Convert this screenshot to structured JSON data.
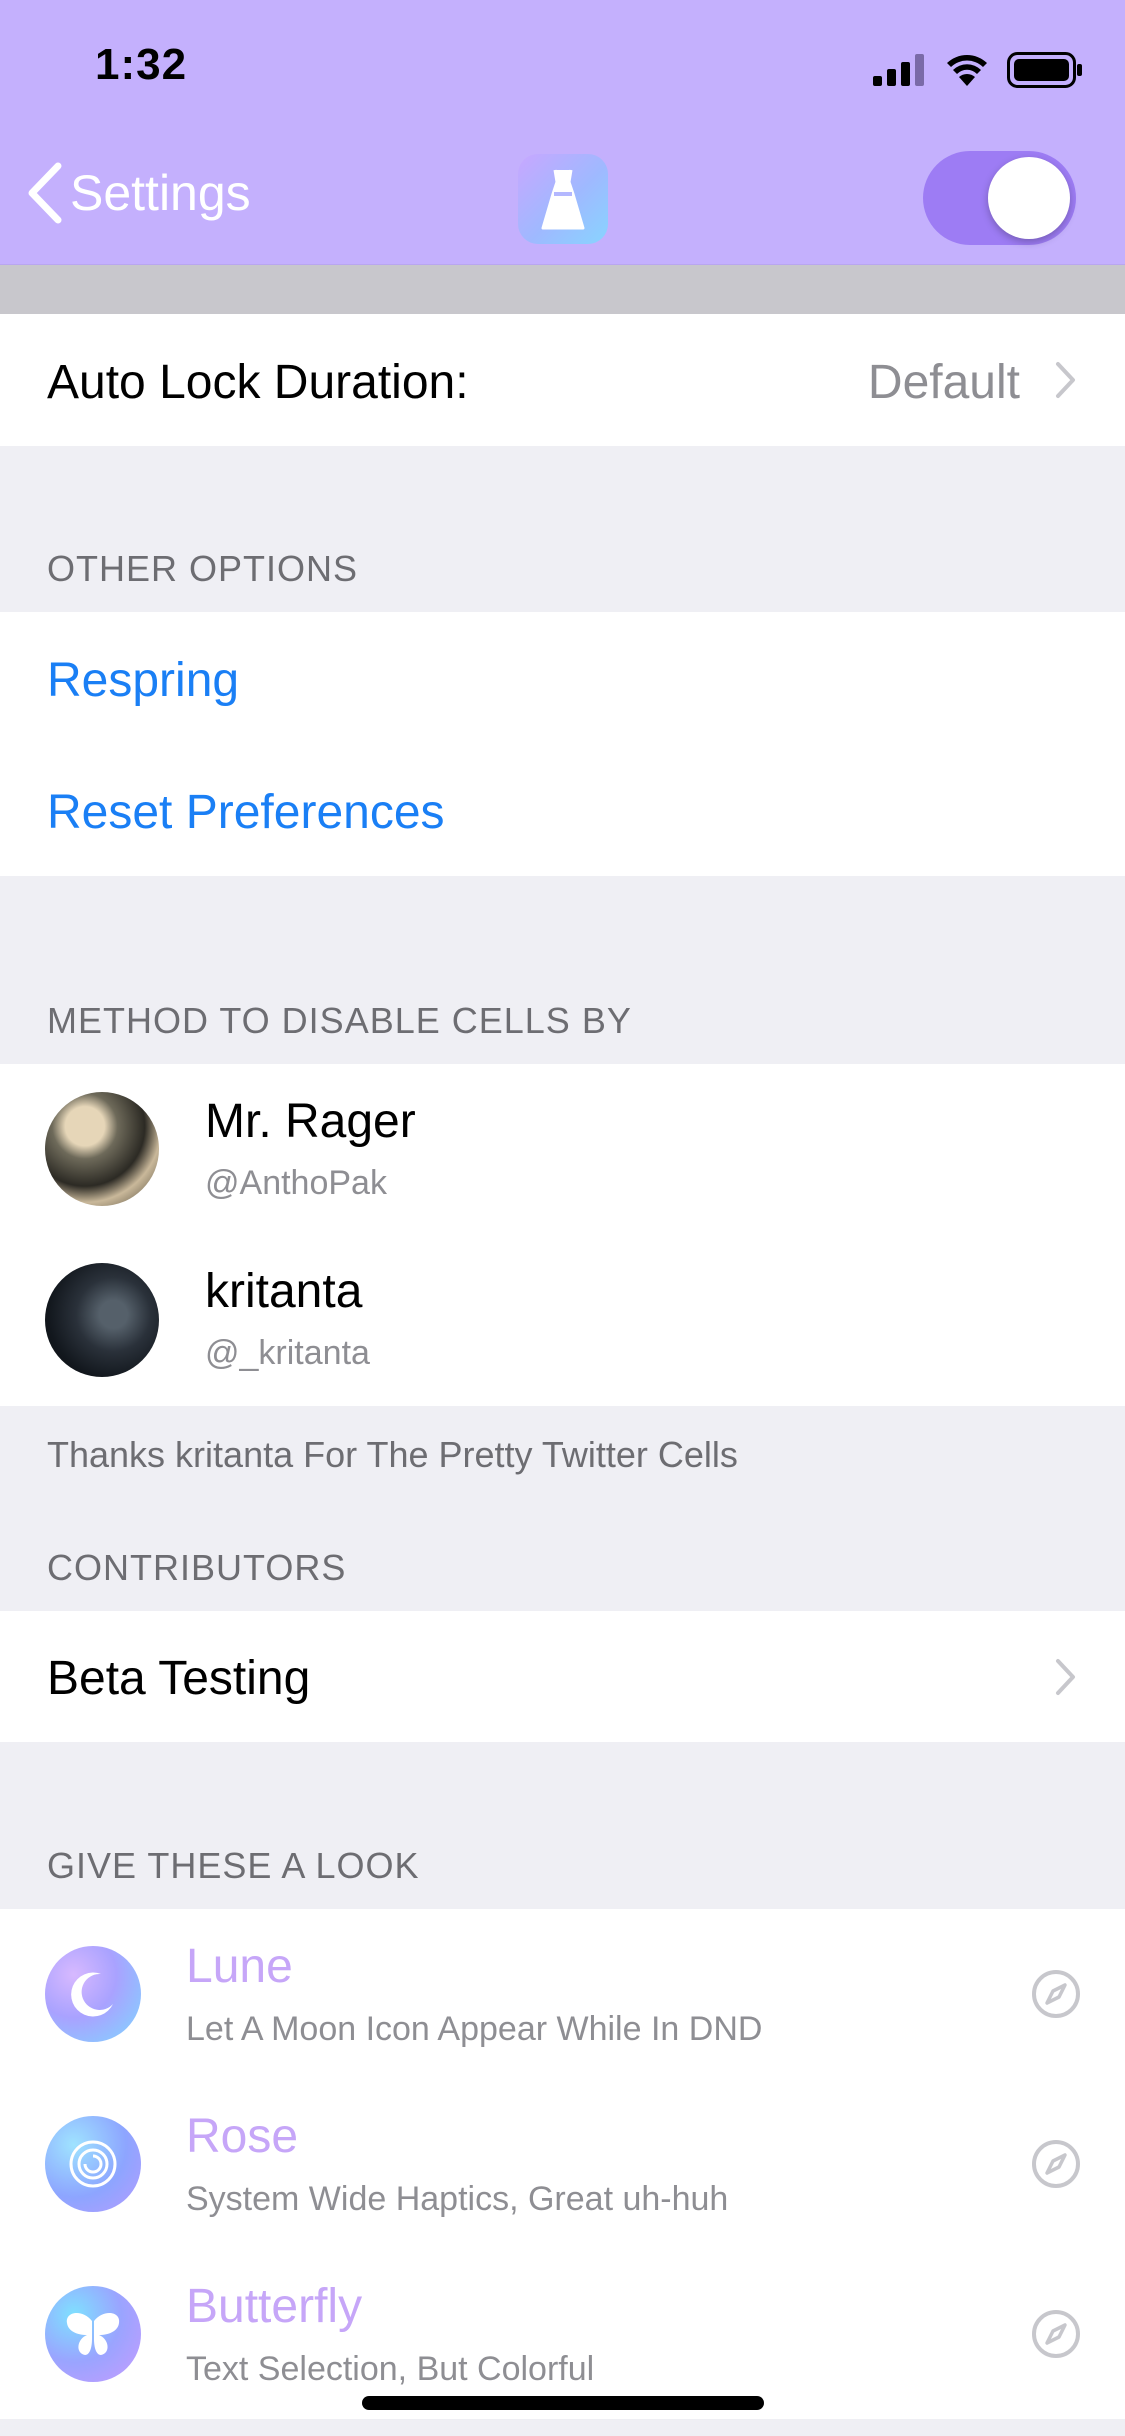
{
  "status_bar": {
    "time": "1:32",
    "icons": [
      "cellular-signal-icon",
      "wifi-icon",
      "battery-icon"
    ]
  },
  "nav": {
    "back_label": "Settings",
    "app_icon": "dress-icon",
    "enabled": true,
    "colors": {
      "bar": "#c4b0fd",
      "toggle_on": "#9d7cf4"
    }
  },
  "auto_lock": {
    "label": "Auto Lock Duration:",
    "value": "Default"
  },
  "other_options": {
    "header": "OTHER OPTIONS",
    "items": [
      "Respring",
      "Reset Preferences"
    ],
    "link_color": "#1a7ff5"
  },
  "method": {
    "header": "METHOD TO DISABLE CELLS BY",
    "people": [
      {
        "name": "Mr. Rager",
        "handle": "@AnthoPak"
      },
      {
        "name": "kritanta",
        "handle": "@_kritanta"
      }
    ],
    "footer": "Thanks kritanta For The Pretty Twitter Cells"
  },
  "contributors": {
    "header": "CONTRIBUTORS",
    "items": [
      "Beta Testing"
    ]
  },
  "give_look": {
    "header": "GIVE THESE A LOOK",
    "tweaks": [
      {
        "name": "Lune",
        "description": "Let A Moon Icon Appear While In DND",
        "icon": "moon-icon"
      },
      {
        "name": "Rose",
        "description": "System Wide Haptics, Great uh-huh",
        "icon": "rose-icon"
      },
      {
        "name": "Butterfly",
        "description": "Text Selection, But Colorful",
        "icon": "butterfly-icon"
      }
    ],
    "name_color": "#c6a6f8"
  }
}
